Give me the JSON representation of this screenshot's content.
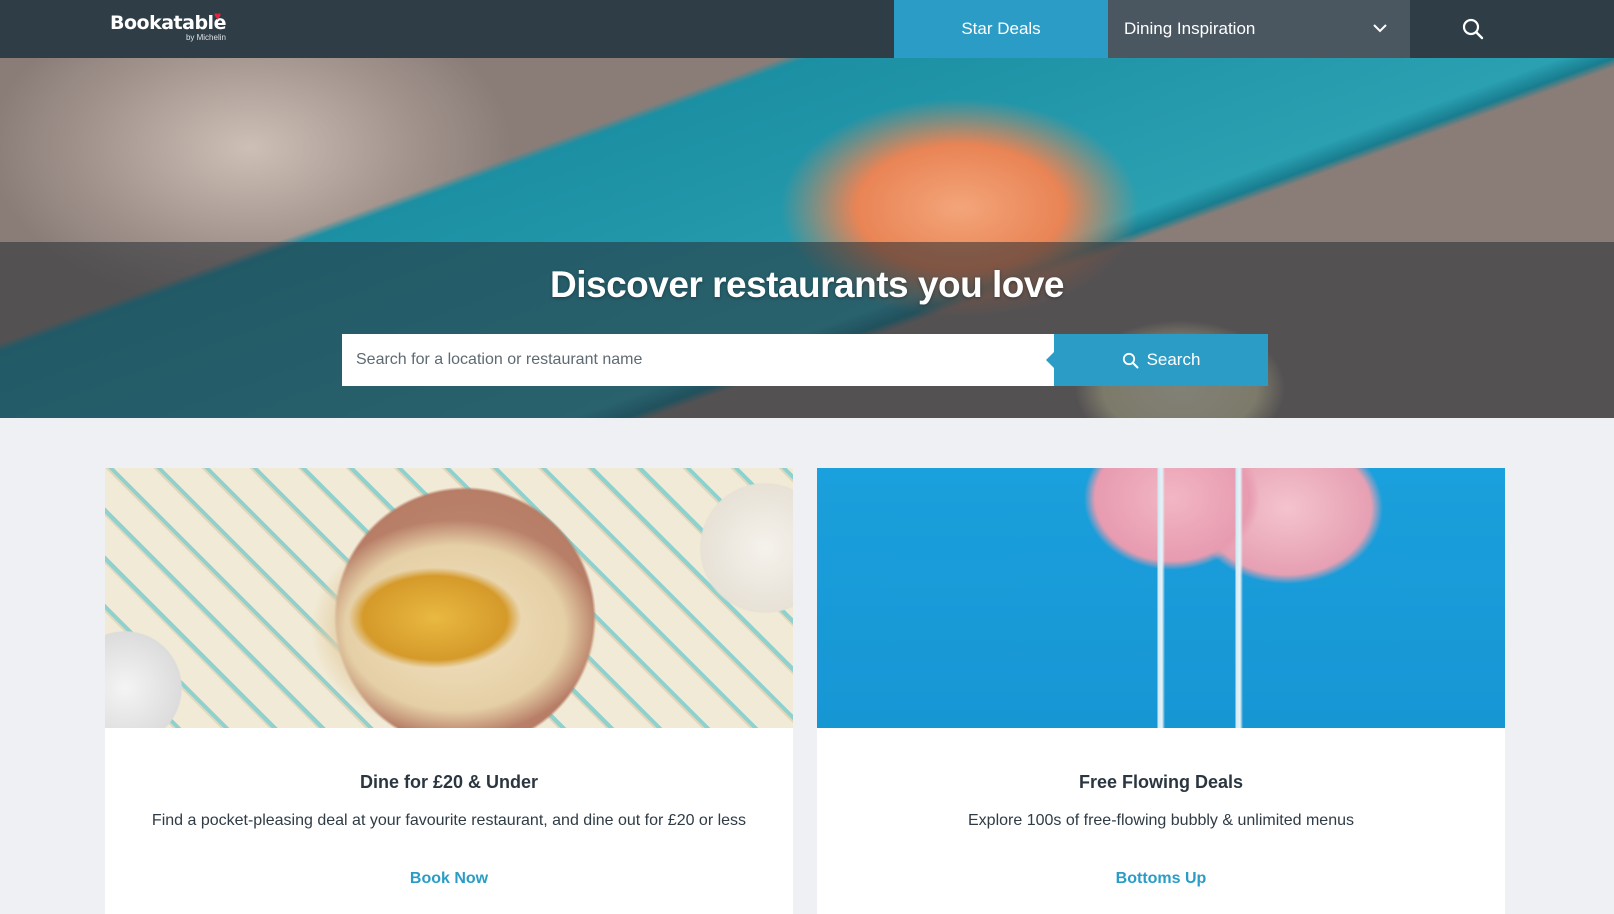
{
  "header": {
    "logo": {
      "name": "Bookatable",
      "sub": "by Michelin"
    },
    "nav": {
      "star_deals": "Star Deals",
      "dining_inspiration": "Dining Inspiration"
    }
  },
  "hero": {
    "title": "Discover restaurants you love",
    "search": {
      "placeholder": "Search for a location or restaurant name",
      "button_label": "Search"
    }
  },
  "cards": [
    {
      "title": "Dine for £20 & Under",
      "description": "Find a pocket-pleasing deal at your favourite restaurant, and dine out for £20 or less",
      "link": "Book Now"
    },
    {
      "title": "Free Flowing Deals",
      "description": "Explore 100s of free-flowing bubbly & unlimited menus",
      "link": "Bottoms Up"
    }
  ],
  "colors": {
    "header_bg": "#2f3d47",
    "accent": "#2a9cc6",
    "page_bg": "#eef0f3"
  },
  "icons": {
    "logo_heart": "heart-icon",
    "dropdown": "chevron-down-icon",
    "search": "search-icon"
  }
}
